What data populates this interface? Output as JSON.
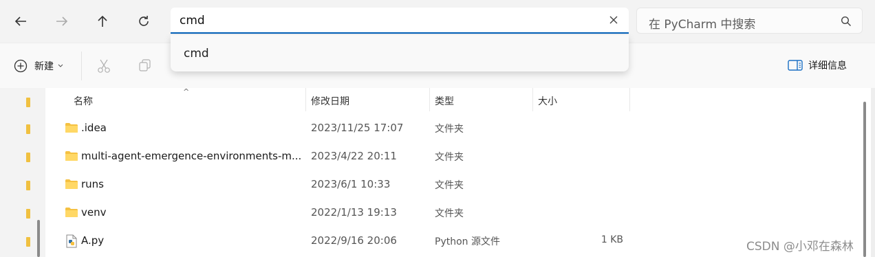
{
  "address_bar": {
    "value": "cmd"
  },
  "search": {
    "placeholder": "在 PyCharm 中搜索"
  },
  "toolbar": {
    "new_label": "新建",
    "details_label": "详细信息"
  },
  "dropdown": {
    "suggestion": "cmd"
  },
  "columns": {
    "name": "名称",
    "date": "修改日期",
    "type": "类型",
    "size": "大小"
  },
  "files": [
    {
      "name": ".idea",
      "date": "2023/11/25 17:07",
      "type": "文件夹",
      "size": "",
      "icon": "folder-icon"
    },
    {
      "name": "multi-agent-emergence-environments-m...",
      "date": "2023/4/22 20:11",
      "type": "文件夹",
      "size": "",
      "icon": "folder-icon"
    },
    {
      "name": "runs",
      "date": "2023/6/1 10:33",
      "type": "文件夹",
      "size": "",
      "icon": "folder-icon"
    },
    {
      "name": "venv",
      "date": "2022/1/13 19:13",
      "type": "文件夹",
      "size": "",
      "icon": "folder-icon"
    },
    {
      "name": "A.py",
      "date": "2022/9/16 20:06",
      "type": "Python 源文件",
      "size": "1 KB",
      "icon": "python-file-icon"
    }
  ],
  "watermark": "CSDN @小邓在森林",
  "colors": {
    "accent": "#005fb8",
    "folder": "#f5c142"
  }
}
